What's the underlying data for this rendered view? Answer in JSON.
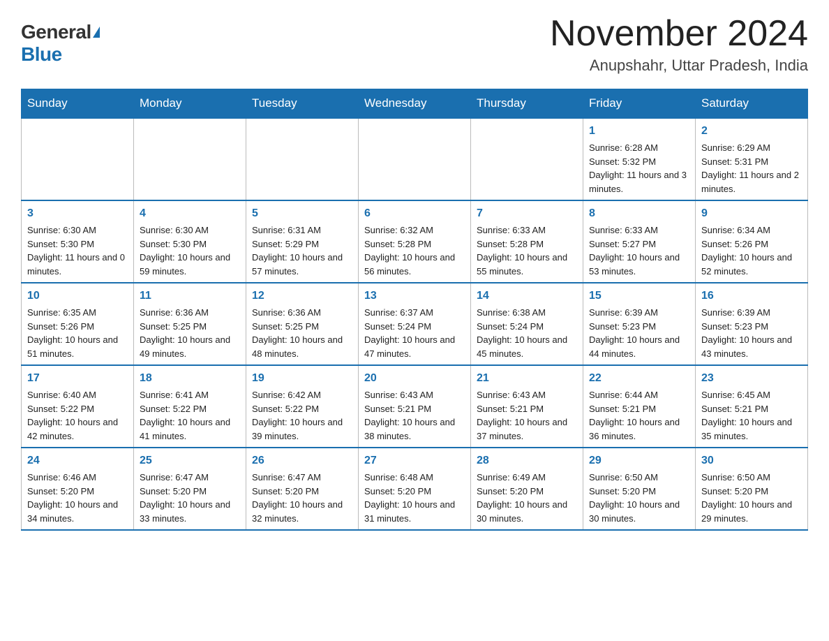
{
  "header": {
    "logo_general": "General",
    "logo_blue": "Blue",
    "month_title": "November 2024",
    "location": "Anupshahr, Uttar Pradesh, India"
  },
  "weekdays": [
    "Sunday",
    "Monday",
    "Tuesday",
    "Wednesday",
    "Thursday",
    "Friday",
    "Saturday"
  ],
  "weeks": [
    [
      {
        "day": "",
        "info": ""
      },
      {
        "day": "",
        "info": ""
      },
      {
        "day": "",
        "info": ""
      },
      {
        "day": "",
        "info": ""
      },
      {
        "day": "",
        "info": ""
      },
      {
        "day": "1",
        "info": "Sunrise: 6:28 AM\nSunset: 5:32 PM\nDaylight: 11 hours and 3 minutes."
      },
      {
        "day": "2",
        "info": "Sunrise: 6:29 AM\nSunset: 5:31 PM\nDaylight: 11 hours and 2 minutes."
      }
    ],
    [
      {
        "day": "3",
        "info": "Sunrise: 6:30 AM\nSunset: 5:30 PM\nDaylight: 11 hours and 0 minutes."
      },
      {
        "day": "4",
        "info": "Sunrise: 6:30 AM\nSunset: 5:30 PM\nDaylight: 10 hours and 59 minutes."
      },
      {
        "day": "5",
        "info": "Sunrise: 6:31 AM\nSunset: 5:29 PM\nDaylight: 10 hours and 57 minutes."
      },
      {
        "day": "6",
        "info": "Sunrise: 6:32 AM\nSunset: 5:28 PM\nDaylight: 10 hours and 56 minutes."
      },
      {
        "day": "7",
        "info": "Sunrise: 6:33 AM\nSunset: 5:28 PM\nDaylight: 10 hours and 55 minutes."
      },
      {
        "day": "8",
        "info": "Sunrise: 6:33 AM\nSunset: 5:27 PM\nDaylight: 10 hours and 53 minutes."
      },
      {
        "day": "9",
        "info": "Sunrise: 6:34 AM\nSunset: 5:26 PM\nDaylight: 10 hours and 52 minutes."
      }
    ],
    [
      {
        "day": "10",
        "info": "Sunrise: 6:35 AM\nSunset: 5:26 PM\nDaylight: 10 hours and 51 minutes."
      },
      {
        "day": "11",
        "info": "Sunrise: 6:36 AM\nSunset: 5:25 PM\nDaylight: 10 hours and 49 minutes."
      },
      {
        "day": "12",
        "info": "Sunrise: 6:36 AM\nSunset: 5:25 PM\nDaylight: 10 hours and 48 minutes."
      },
      {
        "day": "13",
        "info": "Sunrise: 6:37 AM\nSunset: 5:24 PM\nDaylight: 10 hours and 47 minutes."
      },
      {
        "day": "14",
        "info": "Sunrise: 6:38 AM\nSunset: 5:24 PM\nDaylight: 10 hours and 45 minutes."
      },
      {
        "day": "15",
        "info": "Sunrise: 6:39 AM\nSunset: 5:23 PM\nDaylight: 10 hours and 44 minutes."
      },
      {
        "day": "16",
        "info": "Sunrise: 6:39 AM\nSunset: 5:23 PM\nDaylight: 10 hours and 43 minutes."
      }
    ],
    [
      {
        "day": "17",
        "info": "Sunrise: 6:40 AM\nSunset: 5:22 PM\nDaylight: 10 hours and 42 minutes."
      },
      {
        "day": "18",
        "info": "Sunrise: 6:41 AM\nSunset: 5:22 PM\nDaylight: 10 hours and 41 minutes."
      },
      {
        "day": "19",
        "info": "Sunrise: 6:42 AM\nSunset: 5:22 PM\nDaylight: 10 hours and 39 minutes."
      },
      {
        "day": "20",
        "info": "Sunrise: 6:43 AM\nSunset: 5:21 PM\nDaylight: 10 hours and 38 minutes."
      },
      {
        "day": "21",
        "info": "Sunrise: 6:43 AM\nSunset: 5:21 PM\nDaylight: 10 hours and 37 minutes."
      },
      {
        "day": "22",
        "info": "Sunrise: 6:44 AM\nSunset: 5:21 PM\nDaylight: 10 hours and 36 minutes."
      },
      {
        "day": "23",
        "info": "Sunrise: 6:45 AM\nSunset: 5:21 PM\nDaylight: 10 hours and 35 minutes."
      }
    ],
    [
      {
        "day": "24",
        "info": "Sunrise: 6:46 AM\nSunset: 5:20 PM\nDaylight: 10 hours and 34 minutes."
      },
      {
        "day": "25",
        "info": "Sunrise: 6:47 AM\nSunset: 5:20 PM\nDaylight: 10 hours and 33 minutes."
      },
      {
        "day": "26",
        "info": "Sunrise: 6:47 AM\nSunset: 5:20 PM\nDaylight: 10 hours and 32 minutes."
      },
      {
        "day": "27",
        "info": "Sunrise: 6:48 AM\nSunset: 5:20 PM\nDaylight: 10 hours and 31 minutes."
      },
      {
        "day": "28",
        "info": "Sunrise: 6:49 AM\nSunset: 5:20 PM\nDaylight: 10 hours and 30 minutes."
      },
      {
        "day": "29",
        "info": "Sunrise: 6:50 AM\nSunset: 5:20 PM\nDaylight: 10 hours and 30 minutes."
      },
      {
        "day": "30",
        "info": "Sunrise: 6:50 AM\nSunset: 5:20 PM\nDaylight: 10 hours and 29 minutes."
      }
    ]
  ]
}
